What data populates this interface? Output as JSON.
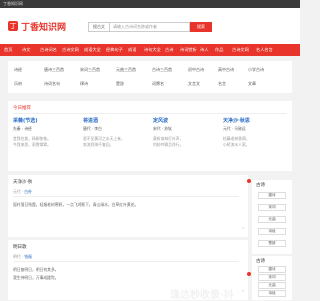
{
  "topbar": {
    "title": "丁香知识网"
  },
  "header": {
    "logo_icon": "丁",
    "logo_text": "丁香知识网",
    "search_label": "搜古文",
    "search_placeholder": "请输入古诗词名称或作者",
    "search_button": "搜索"
  },
  "nav": {
    "items": [
      "首页",
      "诗文",
      "古诗词名",
      "古诗文网",
      "成语大全",
      "经典句子",
      "成语",
      "诗句大全",
      "古诗",
      "诗词赏析",
      "诗人",
      "作品",
      "古诗文网",
      "名人名言"
    ]
  },
  "categories": {
    "row1": [
      "诗经",
      "唐诗三百首",
      "宋词三百首",
      "元曲三百首",
      "古诗三百首",
      "初中古诗",
      "高中古诗",
      "小学古诗"
    ],
    "row2": [
      "乐府",
      "诗词名句",
      "律诗",
      "楚辞",
      "词牌名",
      "文言文",
      "名言",
      "文章"
    ]
  },
  "section": {
    "title": "今日推荐",
    "cards": [
      {
        "title": "采薇(节选)",
        "meta": "先秦 · 诗经",
        "lines": [
          "昔我往矣，杨柳依依。",
          "今我来思，雨雪霏霏。"
        ]
      },
      {
        "title": "将进酒",
        "meta": "唐代 · 李白",
        "lines": [
          "君不见黄河之水天上来，",
          "奔流到海不复回。"
        ]
      },
      {
        "title": "定风波",
        "meta": "宋代 · 苏轼",
        "lines": [
          "莫听穿林打叶声，",
          "何妨吟啸且徐行。"
        ]
      },
      {
        "title": "天净沙·秋思",
        "meta": "元代 · 马致远",
        "lines": [
          "枯藤老树昏鸦，",
          "小桥流水人家。"
        ]
      }
    ]
  },
  "articles": [
    {
      "title": "天净沙·秋",
      "meta_prefix": "元代 · ",
      "author": "白朴",
      "line1": "孤村落日残霞，轻烟老树寒鸦，一点飞鸿影下。青山绿水，白草红叶黄花。",
      "line2": "",
      "more": "›"
    },
    {
      "title": "明日歌",
      "meta_prefix": "明代 · ",
      "author": "钱福",
      "line1": "明日复明日，明日何其多。",
      "line2": "我生待明日，万事成蹉跎。",
      "more": "›"
    }
  ],
  "sidebar": {
    "title": "古诗",
    "items": [
      "唐诗",
      "宋词",
      "元曲",
      "诗经",
      "楚辞"
    ]
  },
  "watermark": "逸达秒收录·抖",
  "colors": {
    "accent": "#e8342b",
    "link": "#2a6cc4"
  }
}
